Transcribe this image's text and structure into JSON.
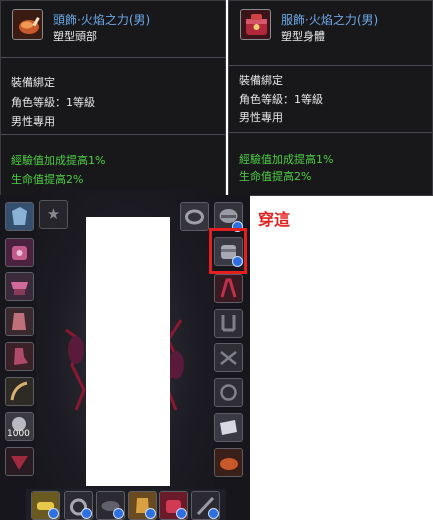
{
  "tooltip_head": {
    "item_name": "頭飾·火焰之力(男)",
    "item_type": "塑型頭部",
    "binding": "裝備綁定",
    "level": "角色等級：1等級",
    "gender": "男性專用",
    "stat_exp": "經驗值加成提高1%",
    "stat_hp": "生命值提高2%"
  },
  "tooltip_body": {
    "item_name": "服飾·火焰之力(男)",
    "item_type": "塑型身體",
    "binding": "裝備綁定",
    "level": "角色等級：1等級",
    "gender": "男性專用",
    "stat_exp": "經驗值加成提高1%",
    "stat_hp": "生命值提高2%"
  },
  "annotation": {
    "text": "穿這",
    "color": "#e32020"
  },
  "slots": {
    "left_bottom_count": "1000"
  },
  "colors": {
    "item_name": "#6ea9e8",
    "stat_text": "#4fcf45",
    "panel_bg": "#16161c",
    "badge": "#2f6fe0"
  },
  "icons": {
    "head_item": "roast-chicken-icon",
    "body_item": "treasure-chest-icon",
    "empty_slot": "star-icon"
  }
}
